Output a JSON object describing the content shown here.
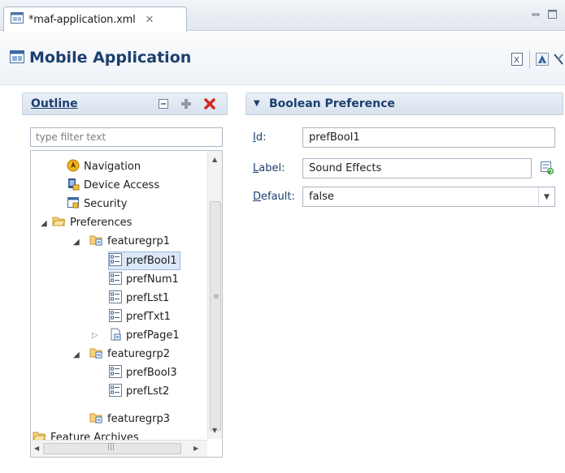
{
  "tab": {
    "title": "*maf-application.xml"
  },
  "header": {
    "title": "Mobile Application"
  },
  "outline": {
    "title": "Outline",
    "filter_placeholder": "type filter text",
    "tree": {
      "navigation": "Navigation",
      "device_access": "Device Access",
      "security": "Security",
      "preferences": "Preferences",
      "featuregrp1": "featuregrp1",
      "prefBool1": "prefBool1",
      "prefNum1": "prefNum1",
      "prefLst1": "prefLst1",
      "prefTxt1": "prefTxt1",
      "prefPage1": "prefPage1",
      "featuregrp2": "featuregrp2",
      "prefBool3": "prefBool3",
      "prefLst2": "prefLst2",
      "featuregrp3": "featuregrp3",
      "feature_archives": "Feature Archives"
    }
  },
  "boolean_preference": {
    "title": "Boolean Preference",
    "id_label": {
      "u": "I",
      "rest": "d:"
    },
    "id_value": "prefBool1",
    "label_label": {
      "u": "L",
      "rest": "abel:"
    },
    "label_value": "Sound Effects",
    "default_label": {
      "u": "D",
      "rest": "efault:"
    },
    "default_value": "false"
  },
  "colors": {
    "title_blue": "#1c3f6e",
    "selection": "#dbe8f8",
    "delete_red": "#d42a1e"
  },
  "icons": [
    "file-xml-icon",
    "close-tab-icon",
    "minimize-icon",
    "maximize-icon",
    "mobile-application-icon",
    "source-view-icon",
    "deploy-icon",
    "tools-icon",
    "collapse-all-icon",
    "add-icon",
    "delete-icon",
    "navigation-icon",
    "device-access-icon",
    "security-icon",
    "folder-icon",
    "feature-group-icon",
    "preference-item-icon",
    "preference-page-icon",
    "refresh-translate-icon",
    "dropdown-arrow-icon"
  ]
}
